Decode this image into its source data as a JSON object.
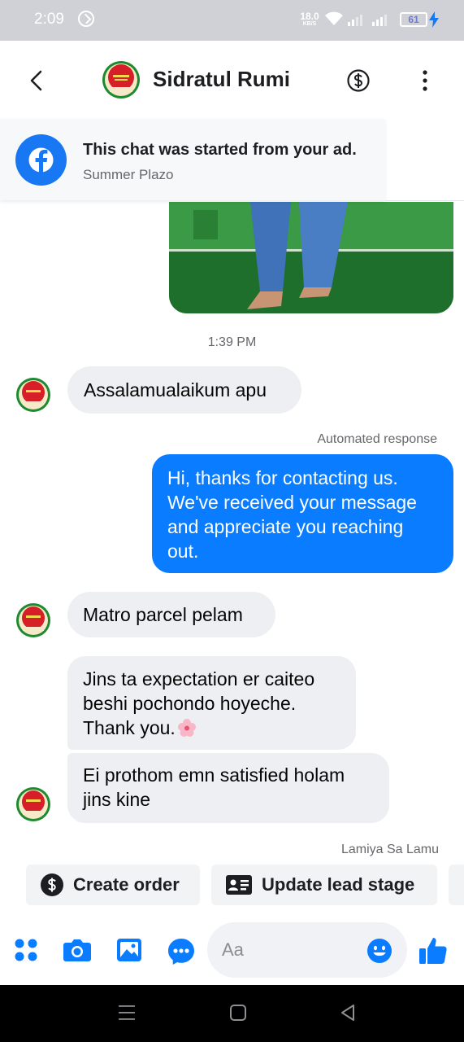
{
  "status_bar": {
    "time": "2:09",
    "net_speed_value": "18.0",
    "net_speed_unit": "KB/S",
    "battery_level": "61",
    "icons": [
      "dnd-icon",
      "wifi-icon",
      "signal-icon",
      "battery-icon",
      "charging-icon"
    ]
  },
  "header": {
    "contact_name": "Sidratul Rumi",
    "icons": [
      "back-icon",
      "dollar-icon",
      "more-icon"
    ]
  },
  "ad_banner": {
    "title": "This chat was started from your ad.",
    "subtitle": "Summer Plazo",
    "icon": "facebook-icon"
  },
  "conversation": {
    "timestamp": "1:39 PM",
    "messages": [
      {
        "direction": "incoming",
        "lines": [
          "Assalamualaikum apu"
        ]
      },
      {
        "direction": "outgoing",
        "label": "Automated response",
        "lines": [
          "Hi, thanks for contacting us.",
          "We've received your message",
          "and appreciate you reaching",
          "out."
        ]
      },
      {
        "direction": "incoming",
        "lines": [
          "Matro parcel pelam"
        ]
      },
      {
        "direction": "incoming",
        "lines": [
          "Jins ta expectation er caiteo",
          "beshi pochondo hoyeche.",
          "Thank you."
        ],
        "emoji": "cherry-blossom"
      },
      {
        "direction": "incoming",
        "lines": [
          "Ei prothom emn satisfied holam",
          "jins kine"
        ]
      }
    ],
    "seen_by": "Lamiya Sa Lamu"
  },
  "quick_actions": [
    {
      "label": "Create order",
      "icon": "dollar-circle-icon"
    },
    {
      "label": "Update lead stage",
      "icon": "id-card-icon"
    }
  ],
  "composer": {
    "placeholder": "Aa",
    "icons": [
      "apps-icon",
      "camera-icon",
      "gallery-icon",
      "sticker-icon",
      "emoji-icon",
      "like-icon"
    ]
  },
  "nav_bar": {
    "icons": [
      "menu-icon",
      "home-icon",
      "back-triangle-icon"
    ]
  },
  "colors": {
    "accent": "#0a7cff",
    "incoming_bubble": "#eeeff2",
    "status_bar": "#cfd1d6"
  }
}
